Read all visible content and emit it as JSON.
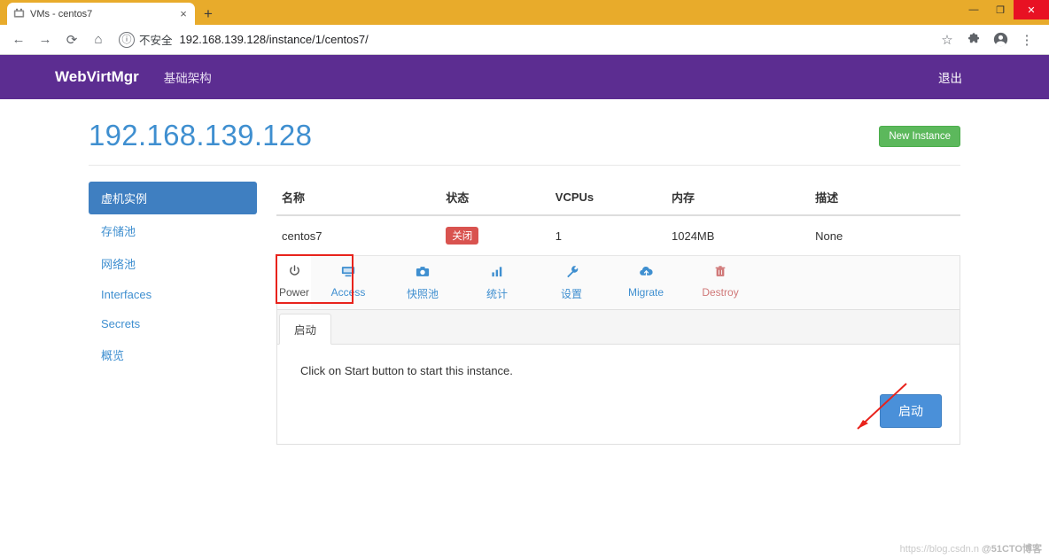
{
  "browser": {
    "tab": {
      "title": "VMs - centos7",
      "favicon_icon": "app-favicon",
      "close_icon": "×"
    },
    "new_tab_icon": "+",
    "window_controls": {
      "minimize": "—",
      "maximize": "❐",
      "close": "✕"
    },
    "nav": {
      "back_icon": "←",
      "forward_icon": "→",
      "reload_icon": "⟳",
      "home_icon": "⌂",
      "info_icon": "ⓘ",
      "security_text": "不安全",
      "url": "192.168.139.128/instance/1/centos7/",
      "star_icon": "☆",
      "extension_icon": "puzzle-piece",
      "profile_icon": "account-circle",
      "menu_icon": "⋮"
    }
  },
  "navbar": {
    "brand": "WebVirtMgr",
    "links": [
      {
        "label": "基础架构"
      }
    ],
    "logout": "退出"
  },
  "header": {
    "host_title": "192.168.139.128",
    "new_instance_button": "New Instance"
  },
  "sidebar": {
    "items": [
      {
        "label": "虚机实例",
        "active": true
      },
      {
        "label": "存储池",
        "active": false
      },
      {
        "label": "网络池",
        "active": false
      },
      {
        "label": "Interfaces",
        "active": false
      },
      {
        "label": "Secrets",
        "active": false
      },
      {
        "label": "概览",
        "active": false
      }
    ]
  },
  "table": {
    "columns": [
      "名称",
      "状态",
      "VCPUs",
      "内存",
      "描述"
    ],
    "rows": [
      {
        "name": "centos7",
        "status": "关闭",
        "vcpus": "1",
        "memory": "1024MB",
        "description": "None"
      }
    ]
  },
  "actions": [
    {
      "label": "Power",
      "icon": "power-icon",
      "glyph": "⏻",
      "active": true,
      "highlighted": true
    },
    {
      "label": "Access",
      "icon": "monitor-icon",
      "glyph": "🖥",
      "active": false
    },
    {
      "label": "快照池",
      "icon": "camera-icon",
      "glyph": "📷",
      "active": false
    },
    {
      "label": "统计",
      "icon": "bar-chart-icon",
      "glyph": "📊",
      "active": false
    },
    {
      "label": "设置",
      "icon": "wrench-icon",
      "glyph": "🔧",
      "active": false
    },
    {
      "label": "Migrate",
      "icon": "cloud-upload-icon",
      "glyph": "☁",
      "active": false
    },
    {
      "label": "Destroy",
      "icon": "trash-icon",
      "glyph": "🗑",
      "active": false
    }
  ],
  "panel": {
    "tabs": [
      {
        "label": "启动",
        "active": true
      }
    ],
    "message": "Click on Start button to start this instance.",
    "start_button": "启动"
  },
  "annotation": {
    "arrow_color": "#e8231c",
    "highlight_color": "#e8231c"
  },
  "watermark": {
    "url": "https://blog.csdn.n",
    "brand": "@51CTO博客"
  },
  "colors": {
    "navbar_purple": "#5c2d91",
    "title_blue": "#3f8fd0",
    "sidebar_active": "#3f7fc1",
    "green_button": "#5cb85c",
    "danger_badge": "#d9534f",
    "start_button": "#4a90d9",
    "chrome_tabstrip": "#e8ab2b"
  }
}
